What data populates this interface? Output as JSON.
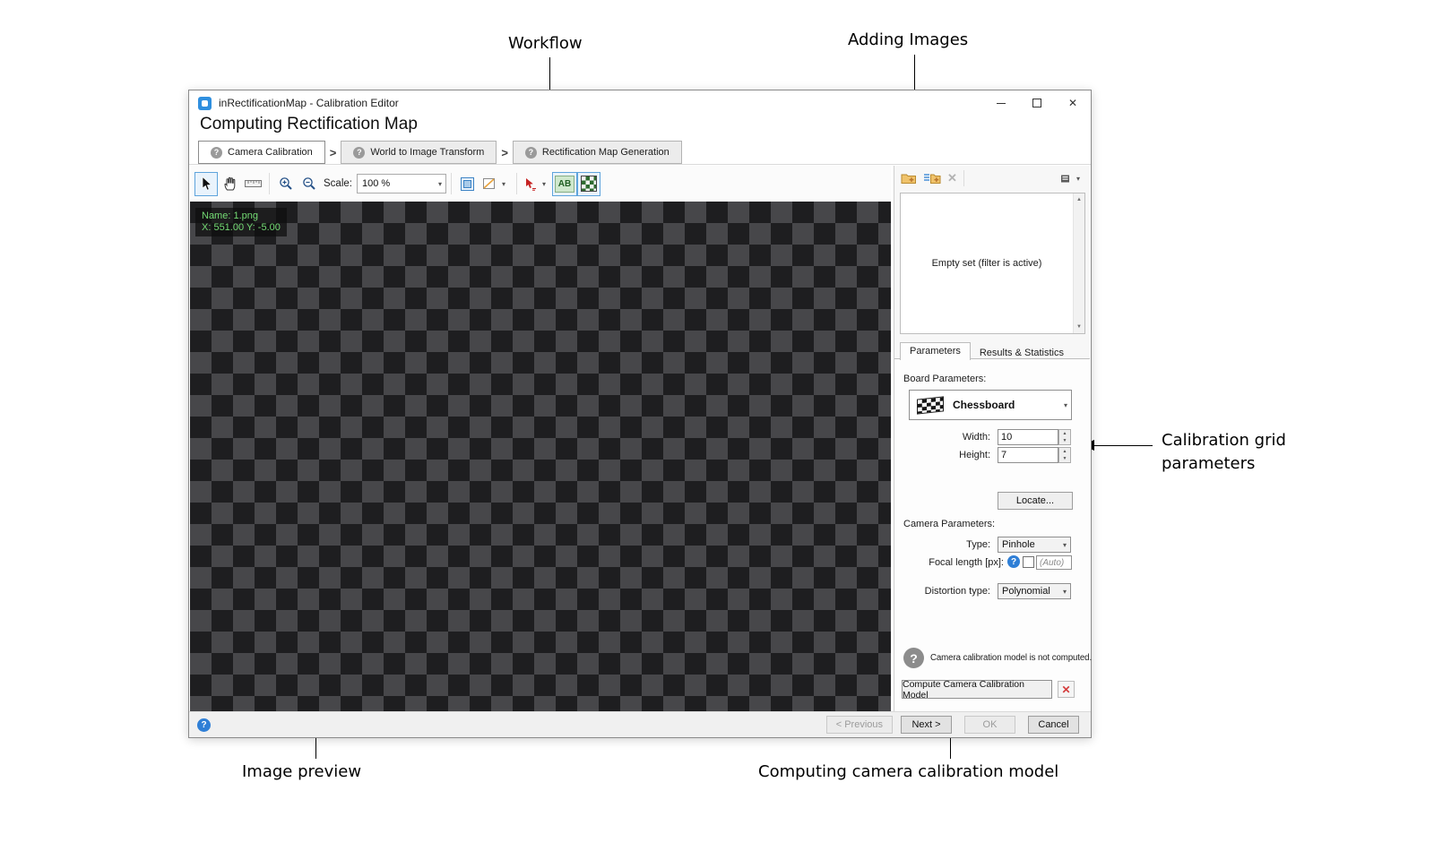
{
  "annotations": {
    "workflow": "Workflow",
    "adding_images": "Adding Images",
    "calibration_grid_line1": "Calibration grid",
    "calibration_grid_line2": "parameters",
    "image_preview": "Image preview",
    "computing_model": "Computing camera calibration model"
  },
  "window": {
    "title": "inRectificationMap - Calibration Editor",
    "heading": "Computing Rectification Map",
    "controls": {
      "close": "✕"
    },
    "tab_separator": ">",
    "workflow_tabs": [
      {
        "label": "Camera Calibration",
        "active": true
      },
      {
        "label": "World to Image Transform",
        "active": false
      },
      {
        "label": "Rectification Map Generation",
        "active": false
      }
    ]
  },
  "toolbar": {
    "scale_label": "Scale:",
    "scale_value": "100 %",
    "ab_icon": "AB"
  },
  "preview": {
    "overlay_name": "Name: 1.png",
    "overlay_coords": "X: 551.00 Y: -5.00"
  },
  "image_list": {
    "empty_text": "Empty set (filter is active)"
  },
  "parameters": {
    "tabs": [
      {
        "label": "Parameters",
        "active": true
      },
      {
        "label": "Results & Statistics",
        "active": false
      }
    ],
    "board_parameters_label": "Board Parameters:",
    "board_type": "Chessboard",
    "width_label": "Width:",
    "width_value": "10",
    "height_label": "Height:",
    "height_value": "7",
    "locate_button": "Locate...",
    "camera_parameters_label": "Camera Parameters:",
    "type_label": "Type:",
    "type_value": "Pinhole",
    "focal_length_label": "Focal length [px]:",
    "focal_length_placeholder": "(Auto)",
    "distortion_label": "Distortion type:",
    "distortion_value": "Polynomial",
    "status_message": "Camera calibration model is not computed.",
    "compute_button": "Compute Camera Calibration Model"
  },
  "footer": {
    "previous": "< Previous",
    "next": "Next >",
    "ok": "OK",
    "cancel": "Cancel"
  },
  "colors": {
    "selection_blue": "#5ea4dc",
    "overlay_green": "#74db74",
    "error_red": "#d43b3b"
  },
  "icons": {
    "help": "?",
    "dropdown_caret": "▾",
    "spinner_up": "▲",
    "spinner_down": "▼",
    "delete_x": "✕"
  }
}
